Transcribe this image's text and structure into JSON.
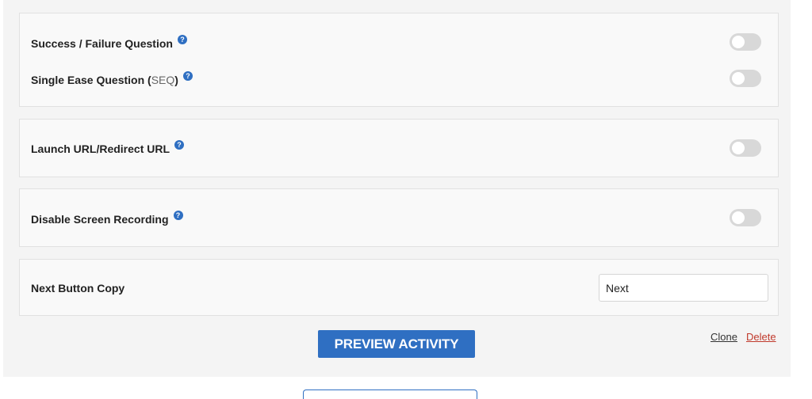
{
  "settings": {
    "success_failure": {
      "label": "Success / Failure Question",
      "help": "?",
      "enabled": false
    },
    "seq": {
      "label": "Single Ease Question (",
      "label_abbr": "SEQ",
      "label_end": ")",
      "help": "?",
      "enabled": false
    },
    "launch_url": {
      "label": "Launch URL/Redirect URL",
      "help": "?",
      "enabled": false
    },
    "disable_recording": {
      "label": "Disable Screen Recording",
      "help": "?",
      "enabled": false
    },
    "next_button_copy": {
      "label": "Next Button Copy",
      "value": "Next"
    }
  },
  "actions": {
    "preview_label": "PREVIEW ACTIVITY",
    "clone_label": "Clone",
    "delete_label": "Delete"
  },
  "colors": {
    "accent": "#2f6fc2",
    "delete": "#c0392b",
    "toggle_off": "#d8d8d8"
  },
  "icons": {
    "help": "question-circle-icon"
  }
}
